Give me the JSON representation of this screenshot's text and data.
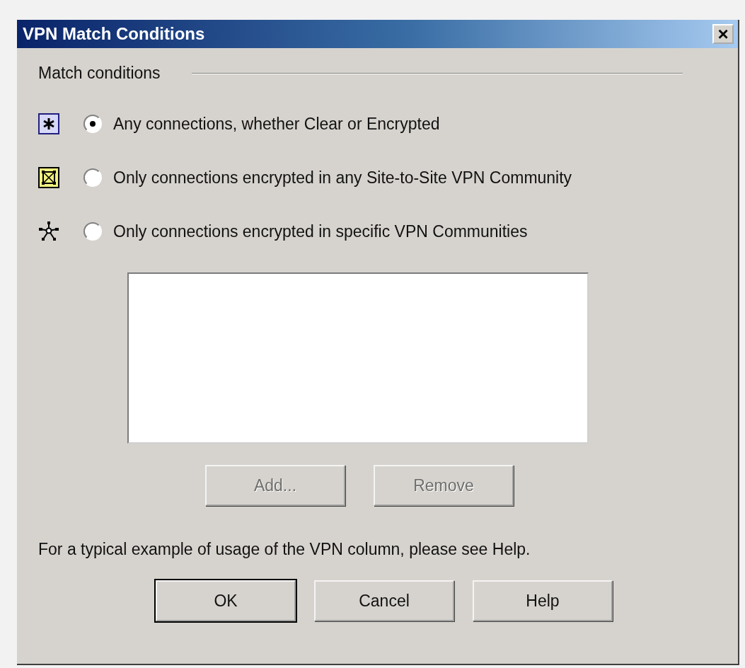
{
  "window": {
    "title": "VPN Match Conditions",
    "close": "×"
  },
  "group": {
    "label": "Match conditions"
  },
  "options": [
    {
      "label": "Any connections, whether Clear or Encrypted",
      "selected": true
    },
    {
      "label": "Only connections encrypted in any Site-to-Site VPN Community",
      "selected": false
    },
    {
      "label": "Only connections encrypted in specific VPN Communities",
      "selected": false
    }
  ],
  "list_buttons": [
    {
      "label": "Add...",
      "disabled": true
    },
    {
      "label": "Remove",
      "disabled": true
    }
  ],
  "note": "For a typical example of usage of the VPN column, please see Help.",
  "buttons": [
    {
      "label": "OK",
      "default": true
    },
    {
      "label": "Cancel",
      "default": false
    },
    {
      "label": "Help",
      "default": false
    }
  ]
}
